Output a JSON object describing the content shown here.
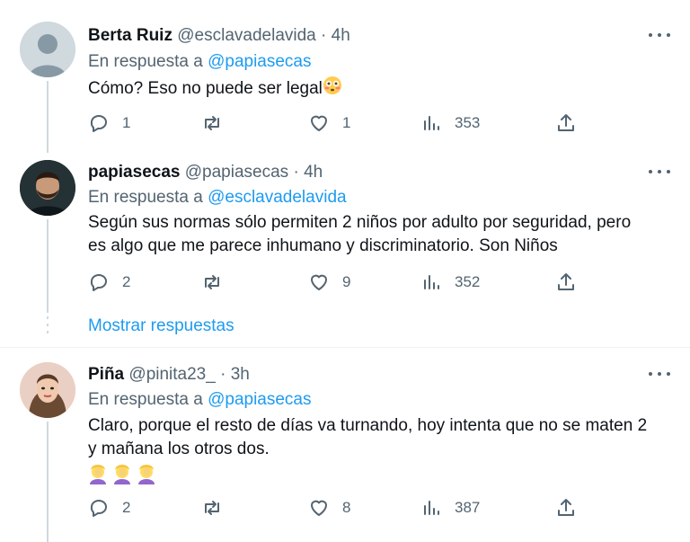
{
  "tweets": [
    {
      "name": "Berta Ruiz",
      "handle": "@esclavadelavida",
      "time": "4h",
      "reply_prefix": "En respuesta a",
      "reply_to": "@papiasecas",
      "text": "Cómo? Eso no puede ser legal",
      "emoji": "flushed-face",
      "stats": {
        "replies": "1",
        "retweets": "",
        "likes": "1",
        "views": "353"
      }
    },
    {
      "name": "papiasecas",
      "handle": "@papiasecas",
      "time": "4h",
      "reply_prefix": "En respuesta a",
      "reply_to": "@esclavadelavida",
      "text_line1": "Según sus normas sólo permiten 2 niños por adulto por seguridad, pero",
      "text_line2": "es algo que me parece inhumano y discriminatorio. Son Niños",
      "stats": {
        "replies": "2",
        "retweets": "",
        "likes": "9",
        "views": "352"
      }
    },
    {
      "name": "Piña",
      "handle": "@pinita23_",
      "time": "3h",
      "reply_prefix": "En respuesta a",
      "reply_to": "@papiasecas",
      "text_line1": "Claro, porque el resto de días va turnando, hoy intenta que no se maten 2",
      "text_line2": "y mañana los otros dos.",
      "emoji": "facepalm-woman x3",
      "stats": {
        "replies": "2",
        "retweets": "",
        "likes": "8",
        "views": "387"
      }
    }
  ],
  "show_replies": "Mostrar respuestas",
  "colors": {
    "accent": "#1d9bf0",
    "muted": "#536471",
    "line": "#cfd9de"
  }
}
